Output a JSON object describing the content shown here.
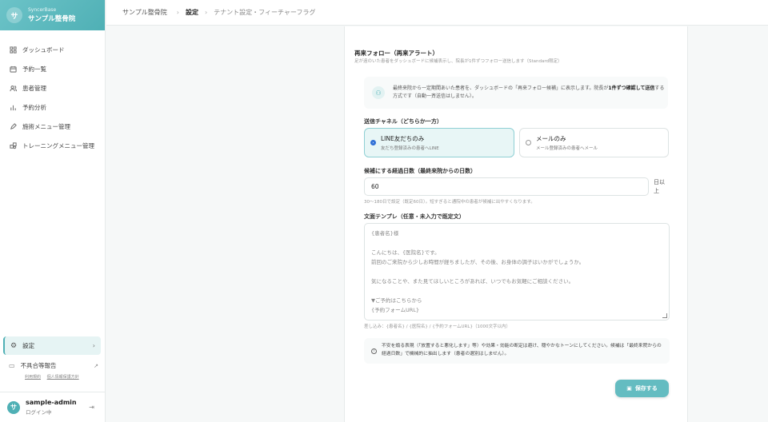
{
  "brand": {
    "logo_letter": "サ",
    "sub": "SyncerBase",
    "name": "サンプル整骨院"
  },
  "nav": {
    "items": [
      {
        "label": "ダッシュボード",
        "icon": "grid-icon"
      },
      {
        "label": "予約一覧",
        "icon": "calendar-icon"
      },
      {
        "label": "患者管理",
        "icon": "users-icon"
      },
      {
        "label": "予約分析",
        "icon": "bar-chart-icon"
      },
      {
        "label": "施術メニュー管理",
        "icon": "pencil-icon"
      },
      {
        "label": "トレーニングメニュー管理",
        "icon": "puzzle-icon"
      }
    ],
    "settings_label": "設定",
    "report_label": "不具合等報告",
    "legal_links": [
      "利用規約",
      "個人情報保護方針"
    ]
  },
  "user": {
    "avatar_letter": "サ",
    "name": "sample-admin",
    "status": "ログイン中"
  },
  "header": {
    "shop": "サンプル整骨院",
    "current": "設定",
    "sub": "テナント設定・フィーチャーフラグ"
  },
  "followup": {
    "title": "再来フォロー（再来アラート）",
    "desc": "足が遠のいた患者をダッシュボードに候補表示し、院長が1件ずつフォロー送信します（Standard限定）",
    "info_pre": "最終来院から一定期間あいた患者を、ダッシュボードの「再来フォロー候補」に表示します。院長が",
    "info_bold": "1件ずつ確認して送信",
    "info_post": "する方式です（自動一斉送信はしません）。",
    "channel_label": "送信チャネル（どちらか一方）",
    "channels": [
      {
        "title": "LINE友だちのみ",
        "sub": "友だち登録済みの患者へLINE",
        "selected": true
      },
      {
        "title": "メールのみ",
        "sub": "メール登録済みの患者へメール",
        "selected": false
      }
    ],
    "days_label": "候補にする経過日数（最終来院からの日数）",
    "days_value": "60",
    "days_unit": "日以上",
    "days_hint": "30〜180日で設定（既定60日）。短すぎると通院中の患者が候補に出やすくなります。",
    "template_label": "文面テンプレ（任意・未入力で既定文）",
    "template_lines": [
      "{患者名}様",
      "",
      "こんにちは、{医院名}です。",
      "前回のご来院から少しお時間が経ちましたが、その後、お身体の調子はいかがでしょうか。",
      "",
      "気になることや、また見てほしいところがあれば、いつでもお気軽にご相談ください。",
      "",
      "▼ご予約はこちらから",
      "{予約フォームURL}"
    ],
    "vars_hint": "差し込み：{患者名} / {医院名} / {予約フォームURL}（1000文字以内）",
    "notice": "不安を煽る表現（「放置すると悪化します」等）や効果・効能の断定は避け、穏やかなトーンにしてください。候補は「最終来院からの経過日数」で機械的に抽出します（患者の選別はしません）。",
    "save_label": "保存する"
  },
  "colors": {
    "accent": "#64bcc1",
    "brand": "#4fb0b5",
    "selected_bg": "#e8f6f6"
  }
}
